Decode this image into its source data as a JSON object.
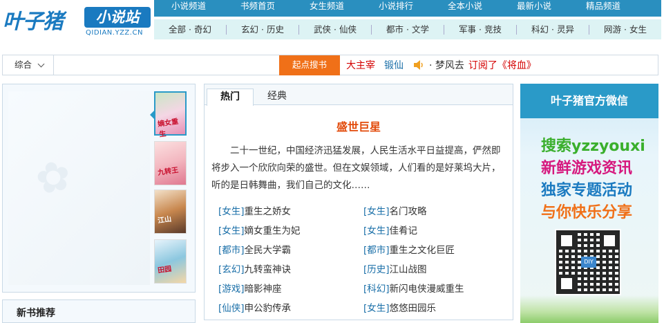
{
  "header": {
    "logo_brand": "叶子猪",
    "logo_badge": "小说站",
    "logo_domain": "QIDIAN.YZZ.CN",
    "nav_top": [
      "小说频道",
      "书频首页",
      "女生频道",
      "小说排行",
      "全本小说",
      "最新小说",
      "精品频道"
    ],
    "nav_bottom": [
      "全部 · 奇幻",
      "玄幻 · 历史",
      "武侠 · 仙侠",
      "都市 · 文学",
      "军事 · 竞技",
      "科幻 · 灵异",
      "网游 · 女生"
    ]
  },
  "search": {
    "type_label": "综合",
    "input_value": "",
    "button_label": "起点搜书",
    "hot1": "大主宰",
    "hot2": "锻仙",
    "broadcast_user": "· 梦风去",
    "broadcast_action": "订阅了《将血》"
  },
  "left": {
    "thumb_texts": [
      "嫡女重生",
      "九转王",
      "江山",
      "田园"
    ],
    "new_books_title": "新书推荐"
  },
  "center": {
    "tabs": [
      "热门",
      "经典"
    ],
    "feature_title": "盛世巨星",
    "feature_desc": "二十一世纪，中国经济迅猛发展，人民生活水平日益提高，俨然即将步入一个欣欣向荣的盛世。但在文娱领域，人们看的是好莱坞大片，听的是日韩舞曲，我们自己的文化……",
    "books": [
      {
        "tag": "[女生]",
        "title": "重生之娇女"
      },
      {
        "tag": "[女生]",
        "title": "名门攻略"
      },
      {
        "tag": "[女生]",
        "title": "嫡女重生为妃"
      },
      {
        "tag": "[女生]",
        "title": "佳肴记"
      },
      {
        "tag": "[都市]",
        "title": "全民大学霸"
      },
      {
        "tag": "[都市]",
        "title": "重生之文化巨匠"
      },
      {
        "tag": "[玄幻]",
        "title": "九转蛮神诀"
      },
      {
        "tag": "[历史]",
        "title": "江山战图"
      },
      {
        "tag": "[游戏]",
        "title": "暗影神座"
      },
      {
        "tag": "[科幻]",
        "title": "新闪电侠漫威重生"
      },
      {
        "tag": "[仙侠]",
        "title": "申公豹传承"
      },
      {
        "tag": "[女生]",
        "title": "悠悠田园乐"
      }
    ]
  },
  "right": {
    "wechat_title": "叶子猪官方微信",
    "promo1": "搜索yzzyouxi",
    "promo2": "新鲜游戏资讯",
    "promo3": "独家专题活动",
    "promo4": "与你快乐分享",
    "qr_center_text": "DIY"
  },
  "colors": {
    "accent": "#2a8fbf",
    "orange": "#f07018",
    "red": "#d40000",
    "link_blue": "#1a6fa8"
  }
}
